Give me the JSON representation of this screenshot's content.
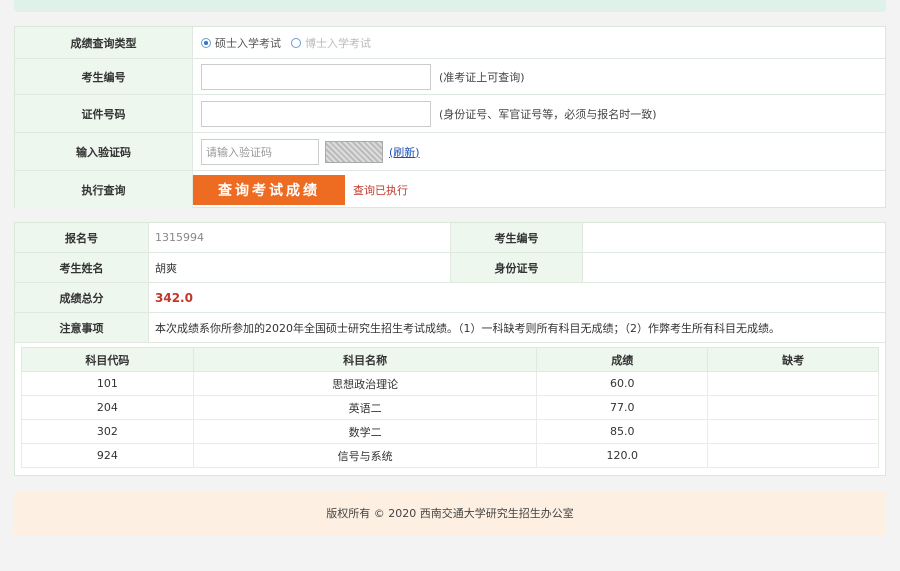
{
  "query": {
    "type_label": "成绩查询类型",
    "type_options": [
      "硕士入学考试",
      "博士入学考试"
    ],
    "exam_no_label": "考生编号",
    "exam_no_hint": "(准考证上可查询)",
    "id_label": "证件号码",
    "id_hint": "(身份证号、军官证号等，必须与报名时一致)",
    "captcha_label": "输入验证码",
    "captcha_placeholder": "请输入验证码",
    "refresh": "(刷新)",
    "exec_label": "执行查询",
    "submit": "查询考试成绩",
    "status": "查询已执行"
  },
  "result": {
    "reg_label": "报名号",
    "reg_value": "1315994",
    "exam_no_label": "考生编号",
    "name_label": "考生姓名",
    "name_value": "胡爽",
    "id_label": "身份证号",
    "total_label": "成绩总分",
    "total_value": "342.0",
    "note_label": "注意事项",
    "note_value": "本次成绩系你所参加的2020年全国硕士研究生招生考试成绩。（1）一科缺考则所有科目无成绩；（2）作弊考生所有科目无成绩。"
  },
  "subjects": {
    "headers": [
      "科目代码",
      "科目名称",
      "成绩",
      "缺考"
    ],
    "rows": [
      [
        "101",
        "思想政治理论",
        "60.0",
        ""
      ],
      [
        "204",
        "英语二",
        "77.0",
        ""
      ],
      [
        "302",
        "数学二",
        "85.0",
        ""
      ],
      [
        "924",
        "信号与系统",
        "120.0",
        ""
      ]
    ]
  },
  "footer": "版权所有 © 2020 西南交通大学研究生招生办公室"
}
